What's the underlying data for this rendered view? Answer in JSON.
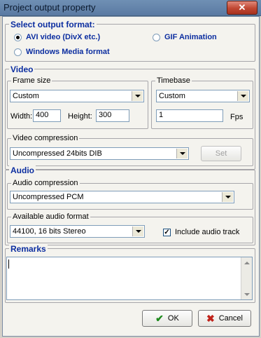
{
  "window": {
    "title": "Project output property",
    "close_glyph": "✕"
  },
  "output_format": {
    "legend": "Select output format:",
    "options": [
      {
        "label": "AVI video (DivX etc.)",
        "selected": true
      },
      {
        "label": "GIF Animation",
        "selected": false
      },
      {
        "label": "Windows Media format",
        "selected": false
      }
    ]
  },
  "video": {
    "legend": "Video",
    "frame_size": {
      "legend": "Frame size",
      "preset": "Custom",
      "width_label": "Width:",
      "width_value": "400",
      "height_label": "Height:",
      "height_value": "300"
    },
    "timebase": {
      "legend": "Timebase",
      "preset": "Custom",
      "value": "1",
      "unit": "Fps"
    },
    "compression": {
      "legend": "Video compression",
      "selected": "Uncompressed 24bits DIB",
      "set_label": "Set"
    }
  },
  "audio": {
    "legend": "Audio",
    "compression": {
      "legend": "Audio compression",
      "selected": "Uncompressed PCM"
    },
    "format": {
      "legend": "Available audio format",
      "selected": "44100, 16 bits Stereo",
      "include_label": "Include audio track",
      "include_checked": true
    }
  },
  "remarks": {
    "legend": "Remarks",
    "value": ""
  },
  "actions": {
    "ok_label": "OK",
    "cancel_label": "Cancel"
  },
  "icons": {
    "ok": "check-icon",
    "cancel": "x-icon",
    "dropdown": "chevron-down-icon"
  }
}
